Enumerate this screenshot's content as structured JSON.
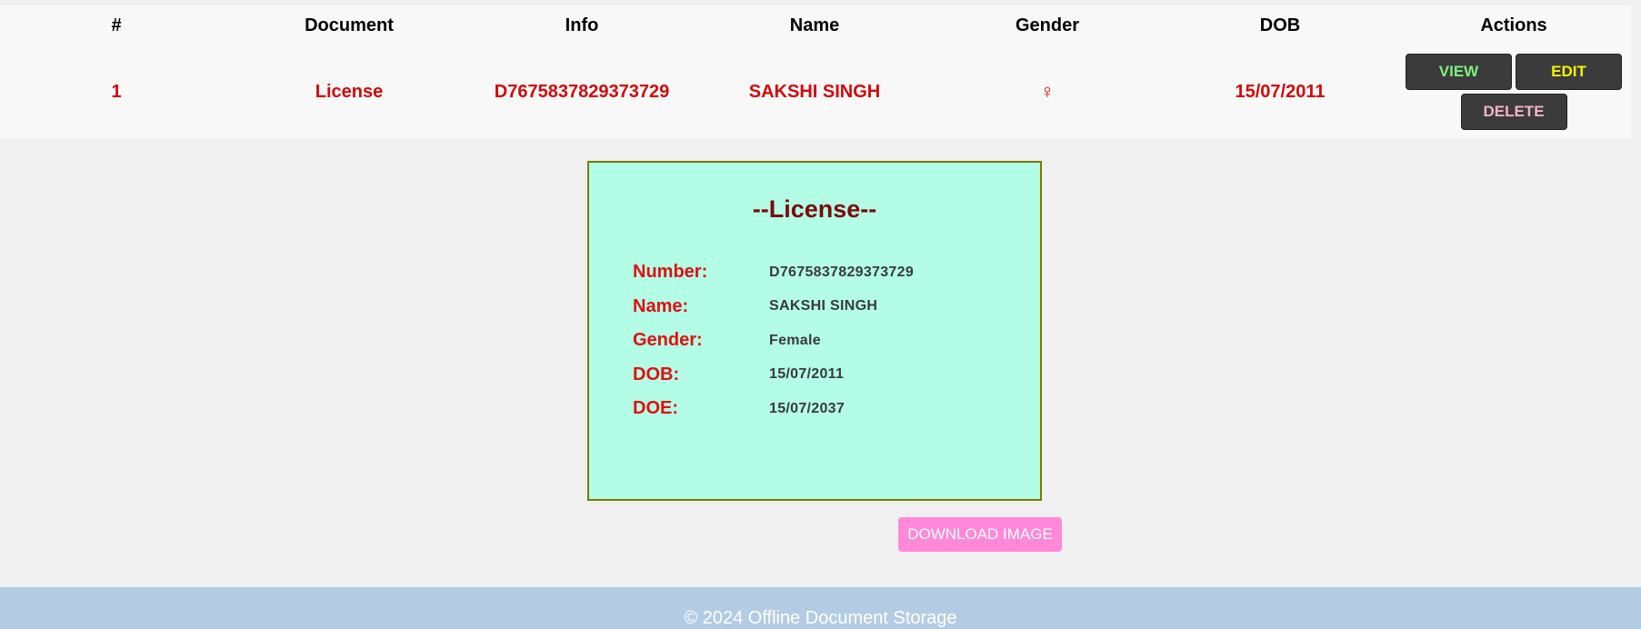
{
  "table": {
    "headers": [
      "#",
      "Document",
      "Info",
      "Name",
      "Gender",
      "DOB",
      "Actions"
    ],
    "rows": [
      {
        "index": "1",
        "document": "License",
        "info": "D7675837829373729",
        "name": "SAKSHI SINGH",
        "gender_symbol": "♀",
        "dob": "15/07/2011"
      }
    ],
    "actions": {
      "view_label": "VIEW",
      "edit_label": "EDIT",
      "delete_label": "DELETE"
    }
  },
  "card": {
    "title": "--License--",
    "fields": [
      {
        "label": "Number:",
        "value": "D7675837829373729"
      },
      {
        "label": "Name:",
        "value": "SAKSHI SINGH"
      },
      {
        "label": "Gender:",
        "value": "Female"
      },
      {
        "label": "DOB:",
        "value": "15/07/2011"
      },
      {
        "label": "DOE:",
        "value": "15/07/2037"
      }
    ]
  },
  "download_label": "DOWNLOAD IMAGE",
  "footer": {
    "text": "© 2024 Offline Document Storage"
  },
  "colors": {
    "background": "#f0f0f0",
    "table_bg": "#f8f8f8",
    "cell_text": "#d10a0a",
    "button_bg": "#3b3b3b",
    "view_text": "#7cf27c",
    "edit_text": "#f5f200",
    "delete_text": "#f2b3c6",
    "card_bg": "#b3fde6",
    "card_border": "#7a7a00",
    "card_title": "#7a0a0a",
    "card_label": "#e01010",
    "download_bg": "#ff88d8",
    "footer_bg": "#b4cbe4"
  }
}
